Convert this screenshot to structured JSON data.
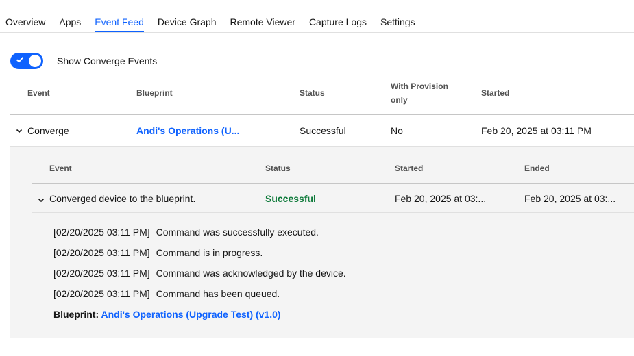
{
  "tabs": [
    "Overview",
    "Apps",
    "Event Feed",
    "Device Graph",
    "Remote Viewer",
    "Capture Logs",
    "Settings"
  ],
  "active_tab": "Event Feed",
  "toggle": {
    "label": "Show Converge Events",
    "on": true
  },
  "outer_table": {
    "headers": {
      "event": "Event",
      "blueprint": "Blueprint",
      "status": "Status",
      "with_provision_1": "With Provision",
      "with_provision_2": "only",
      "started": "Started"
    },
    "row": {
      "event": "Converge",
      "blueprint": "Andi's Operations (U...",
      "status": "Successful",
      "with_provision": "No",
      "started": "Feb 20, 2025 at 03:11 PM"
    }
  },
  "inner_table": {
    "headers": {
      "event": "Event",
      "status": "Status",
      "started": "Started",
      "ended": "Ended"
    },
    "row": {
      "event": "Converged device to the blueprint.",
      "status": "Successful",
      "started": "Feb 20, 2025 at 03:...",
      "ended": "Feb 20, 2025 at 03:..."
    }
  },
  "logs": [
    {
      "ts": "[02/20/2025 03:11 PM]",
      "msg": "Command was successfully executed."
    },
    {
      "ts": "[02/20/2025 03:11 PM]",
      "msg": "Command is in progress."
    },
    {
      "ts": "[02/20/2025 03:11 PM]",
      "msg": "Command was acknowledged by the device."
    },
    {
      "ts": "[02/20/2025 03:11 PM]",
      "msg": "Command has been queued."
    }
  ],
  "blueprint_line": {
    "label": "Blueprint:",
    "link": "Andi's Operations (Upgrade Test) (v1.0)"
  },
  "colors": {
    "accent": "#0f62fe",
    "success": "#0e7a3a",
    "panel_bg": "#f4f4f4"
  }
}
